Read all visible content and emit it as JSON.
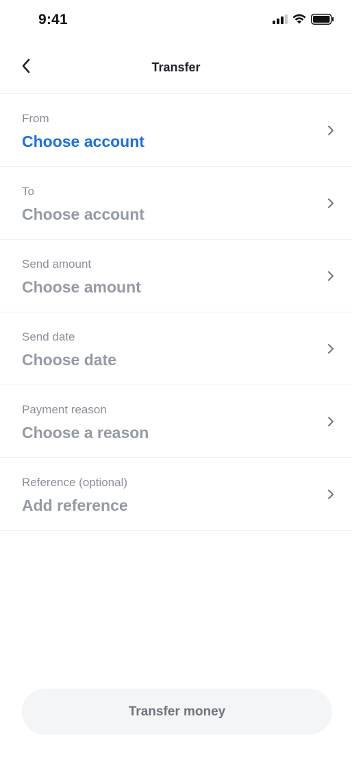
{
  "status_bar": {
    "time": "9:41"
  },
  "header": {
    "back_icon": "chevron-left-icon",
    "title": "Transfer"
  },
  "rows": [
    {
      "label": "From",
      "value": "Choose account",
      "active": true
    },
    {
      "label": "To",
      "value": "Choose account",
      "active": false
    },
    {
      "label": "Send amount",
      "value": "Choose amount",
      "active": false
    },
    {
      "label": "Send date",
      "value": "Choose date",
      "active": false
    },
    {
      "label": "Payment reason",
      "value": "Choose a reason",
      "active": false
    },
    {
      "label": "Reference (optional)",
      "value": "Add reference",
      "active": false
    }
  ],
  "footer": {
    "button_label": "Transfer money"
  },
  "colors": {
    "accent": "#1a6fe8",
    "label": "#8a9099",
    "placeholder_value": "#959ba3",
    "button_bg": "#f4f5f7",
    "button_text": "#6e747c",
    "divider": "#eef0f2"
  }
}
